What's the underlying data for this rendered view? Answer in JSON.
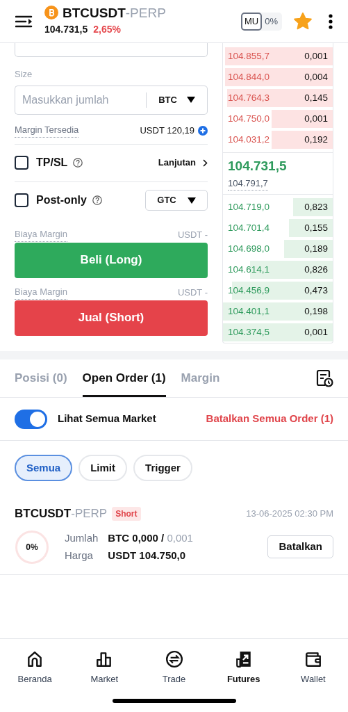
{
  "header": {
    "symbol": "BTCUSDT",
    "suffix": "-PERP",
    "price": "104.731,5",
    "change": "2,65%",
    "mode_badge": "MU",
    "mode_value": "0%",
    "favorite": true
  },
  "form": {
    "size_label": "Size",
    "size_placeholder": "Masukkan jumlah",
    "size_unit": "BTC",
    "margin_label": "Margin Tersedia",
    "margin_value": "USDT 120,19",
    "options": [
      {
        "kind": "link",
        "label": "TP/SL",
        "checked": false,
        "action": "Lanjutan"
      },
      {
        "kind": "select",
        "label": "Post-only",
        "checked": false,
        "action": "GTC"
      }
    ],
    "actions": [
      {
        "cost_label": "Biaya Margin",
        "cost_value": "USDT -",
        "button": "Beli (Long)"
      },
      {
        "cost_label": "Biaya Margin",
        "cost_value": "USDT -",
        "button": "Jual (Short)"
      }
    ]
  },
  "orderbook": {
    "asks": [
      {
        "price": "104.855,7",
        "qty": "0,001"
      },
      {
        "price": "104.844,0",
        "qty": "0,004"
      },
      {
        "price": "104.764,3",
        "qty": "0,145"
      },
      {
        "price": "104.750,0",
        "qty": "0,001"
      },
      {
        "price": "104.031,2",
        "qty": "0,192"
      }
    ],
    "last_price": "104.731,5",
    "mark_price": "104.791,7",
    "bids": [
      {
        "price": "104.719,0",
        "qty": "0,823"
      },
      {
        "price": "104.701,4",
        "qty": "0,155"
      },
      {
        "price": "104.698,0",
        "qty": "0,189"
      },
      {
        "price": "104.614,1",
        "qty": "0,826"
      },
      {
        "price": "104.456,9",
        "qty": "0,473"
      },
      {
        "price": "104.401,1",
        "qty": "0,198"
      },
      {
        "price": "104.374,5",
        "qty": "0,001"
      }
    ]
  },
  "tabs": [
    {
      "label": "Posisi (0)",
      "selected": false
    },
    {
      "label": "Open Order (1)",
      "selected": true
    },
    {
      "label": "Margin",
      "selected": false
    }
  ],
  "toggle": {
    "label": "Lihat Semua Market",
    "on": true
  },
  "cancel_all": "Batalkan Semua Order (1)",
  "filters": [
    {
      "label": "Semua",
      "selected": true
    },
    {
      "label": "Limit",
      "selected": false
    },
    {
      "label": "Trigger",
      "selected": false
    }
  ],
  "orders": [
    {
      "symbol": "BTCUSDT",
      "suffix": "-PERP",
      "side": "Short",
      "time": "13-06-2025 02:30 PM",
      "filled": "0%",
      "level": 0,
      "fields": [
        {
          "label": "Jumlah",
          "value": "BTC 0,000 /",
          "extra": "0,001"
        },
        {
          "label": "Harga",
          "value": "USDT 104.750,0"
        }
      ],
      "button": "Batalkan"
    }
  ],
  "nav": [
    {
      "label": "Beranda",
      "selected": false
    },
    {
      "label": "Market",
      "selected": false
    },
    {
      "label": "Trade",
      "selected": false
    },
    {
      "label": "Futures",
      "selected": true
    },
    {
      "label": "Wallet",
      "selected": false
    }
  ]
}
